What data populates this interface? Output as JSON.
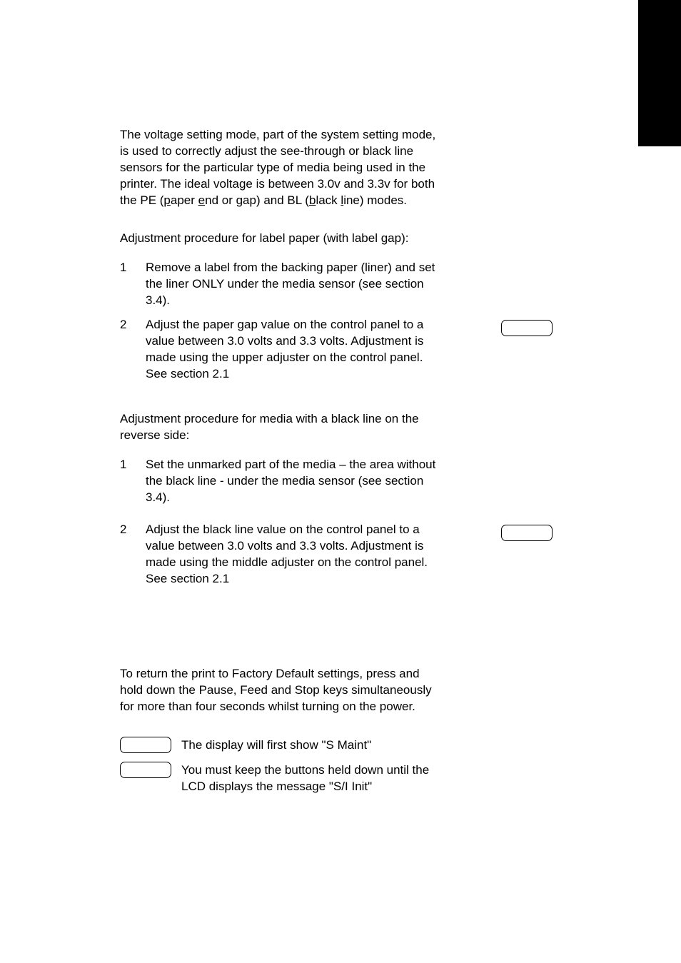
{
  "section1": {
    "intro_prefix": "The voltage setting mode, part of the system setting mode, is used to correctly adjust the see-through or black line sensors for the particular type of media being used in the printer.    The ideal voltage is between 3.0v and 3.3v for both the PE (",
    "intro_p": "p",
    "intro_aper": "aper ",
    "intro_e": "e",
    "intro_nd": "nd or gap) and BL (",
    "intro_b": "b",
    "intro_lack": "lack ",
    "intro_l": "l",
    "intro_suffix": "ine) modes.",
    "proc1_heading": "Adjustment procedure for label paper (with label gap):",
    "proc1_item1_num": "1",
    "proc1_item1_text": "Remove a label from the backing paper (liner) and set the liner ONLY under the media sensor (see section 3.4).",
    "proc1_item2_num": "2",
    "proc1_item2_text": "Adjust the paper gap value on the control panel to a value between 3.0 volts and 3.3 volts.    Adjustment is made using the upper adjuster on the control panel.    See section 2.1",
    "proc2_heading": "Adjustment procedure for media with a black line on the reverse side:",
    "proc2_item1_num": "1",
    "proc2_item1_text": "Set the unmarked part of the media – the area without the black line - under the media sensor (see section 3.4).",
    "proc2_item2_num": "2",
    "proc2_item2_text": "Adjust the black line value on the control panel to a value between 3.0 volts and 3.3 volts.    Adjustment is made using the middle adjuster on the control panel.    See section 2.1"
  },
  "section2": {
    "intro": "To return the print to Factory Default settings, press and hold down the Pause, Feed and Stop keys simultaneously for more than four seconds whilst turning on the power.",
    "row1": "The display will first show \"S Maint\"",
    "row2": "You must keep the buttons held down until the LCD displays the message \"S/I Init\""
  }
}
